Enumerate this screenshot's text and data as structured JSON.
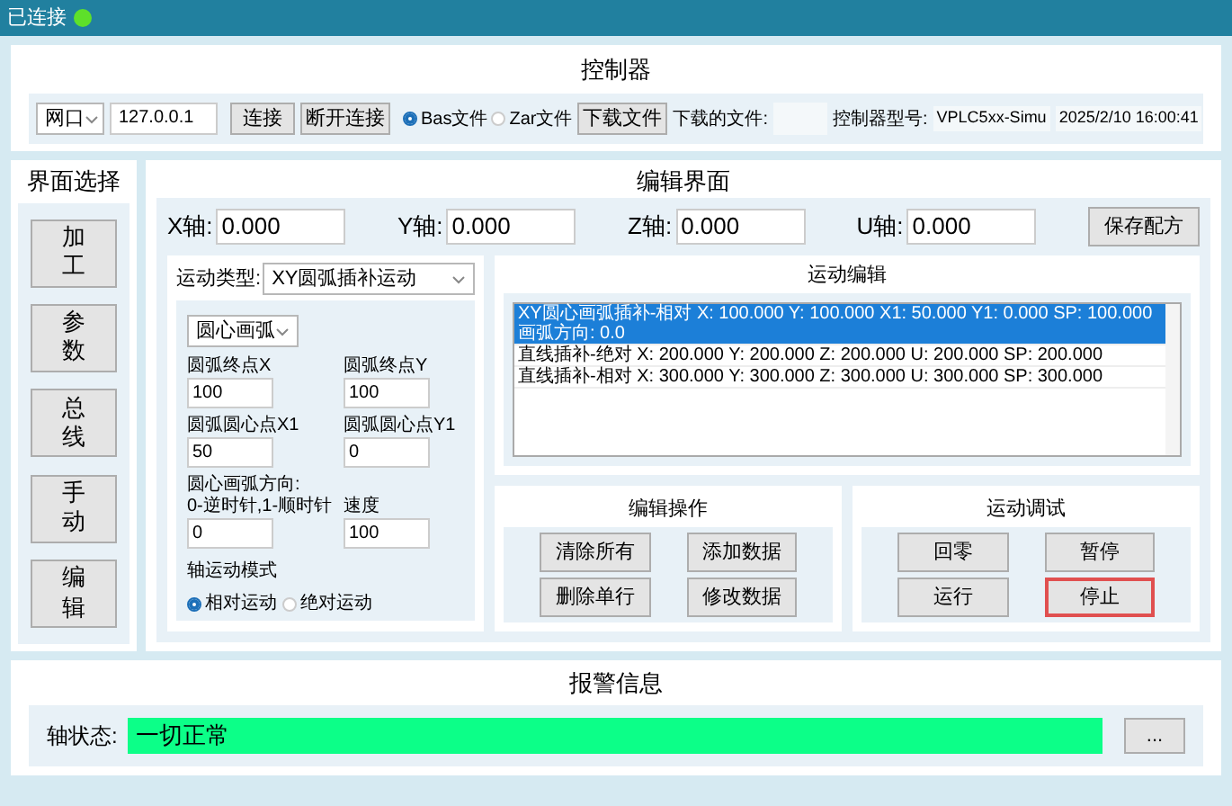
{
  "status_bar": {
    "text": "已连接",
    "connected": true
  },
  "controller": {
    "title": "控制器",
    "port": "网口",
    "ip": "127.0.0.1",
    "connect": "连接",
    "disconnect": "断开连接",
    "file_types": [
      {
        "label": "Bas文件",
        "selected": true
      },
      {
        "label": "Zar文件",
        "selected": false
      }
    ],
    "download": "下载文件",
    "downloaded_label": "下载的文件:",
    "model_label": "控制器型号:",
    "model": "VPLC5xx-Simu",
    "datetime": "2025/2/10 16:00:41"
  },
  "nav": {
    "title": "界面选择",
    "items": [
      "加工",
      "参数",
      "总线",
      "手动",
      "编辑"
    ]
  },
  "editor": {
    "title": "编辑界面",
    "axes": [
      {
        "label": "X轴:",
        "value": "0.000"
      },
      {
        "label": "Y轴:",
        "value": "0.000"
      },
      {
        "label": "Z轴:",
        "value": "0.000"
      },
      {
        "label": "U轴:",
        "value": "0.000"
      }
    ],
    "save": "保存配方",
    "motion_type": {
      "label": "运动类型:",
      "value": "XY圆弧插补运动"
    },
    "arc_mode": "圆心画弧",
    "fields": [
      {
        "label": "圆弧终点X",
        "value": "100"
      },
      {
        "label": "圆弧终点Y",
        "value": "100"
      },
      {
        "label": "圆弧圆心点X1",
        "value": "50"
      },
      {
        "label": "圆弧圆心点Y1",
        "value": "0"
      },
      {
        "label": "圆心画弧方向:\n0-逆时针,1-顺时针",
        "value": "0"
      },
      {
        "label": "速度",
        "value": "100"
      }
    ],
    "mode": {
      "label": "轴运动模式",
      "options": [
        {
          "label": "相对运动",
          "selected": true
        },
        {
          "label": "绝对运动",
          "selected": false
        }
      ]
    },
    "list": {
      "title": "运动编辑",
      "rows": [
        {
          "text": "XY圆心画弧插补-相对 X: 100.000 Y: 100.000 X1: 50.000 Y1: 0.000 SP: 100.000 画弧方向: 0.0",
          "selected": true
        },
        {
          "text": "直线插补-绝对 X: 200.000 Y: 200.000 Z: 200.000 U: 200.000 SP: 200.000",
          "selected": false
        },
        {
          "text": "直线插补-相对 X: 300.000 Y: 300.000 Z: 300.000 U: 300.000 SP: 300.000",
          "selected": false
        }
      ]
    },
    "edit_ops": {
      "title": "编辑操作",
      "buttons": [
        {
          "label": "清除所有",
          "focused": false
        },
        {
          "label": "添加数据",
          "focused": false
        },
        {
          "label": "删除单行",
          "focused": false
        },
        {
          "label": "修改数据",
          "focused": false
        }
      ]
    },
    "debug": {
      "title": "运动调试",
      "buttons": [
        {
          "label": "回零",
          "focused": false
        },
        {
          "label": "暂停",
          "focused": false
        },
        {
          "label": "运行",
          "focused": false
        },
        {
          "label": "停止",
          "focused": true
        }
      ]
    }
  },
  "alarm": {
    "title": "报警信息",
    "label": "轴状态:",
    "value": "一切正常",
    "ok": true,
    "more": "..."
  }
}
